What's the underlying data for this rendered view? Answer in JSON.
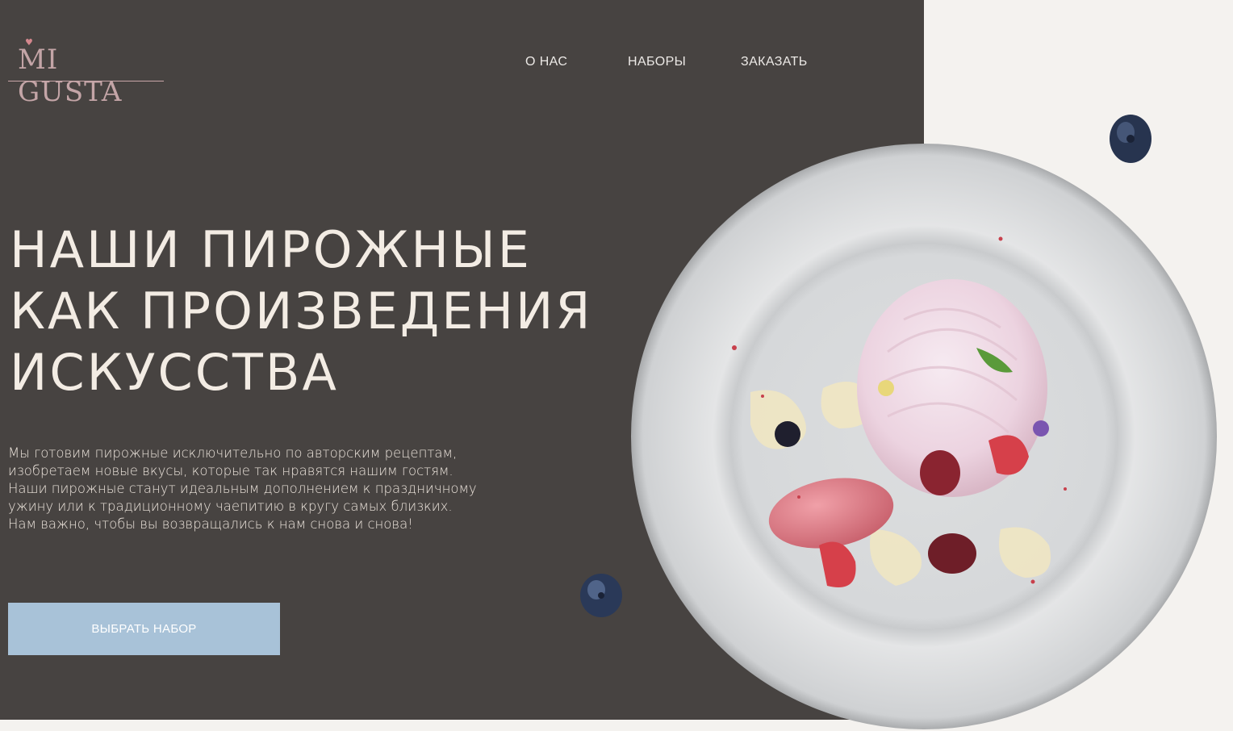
{
  "brand": {
    "logo_text": "MI GUSTA",
    "heart_glyph": "♥"
  },
  "nav": {
    "items": [
      "О НАС",
      "НАБОРЫ",
      "ЗАКАЗАТЬ"
    ]
  },
  "hero": {
    "title_lines": [
      "НАШИ ПИРОЖНЫЕ",
      "КАК ПРОИЗВЕДЕНИЯ",
      "ИСКУССТВА"
    ],
    "description_lines": [
      "Мы готовим пирожные исключительно по авторским рецептам,",
      "изобретаем новые вкусы, которые так нравятся нашим гостям.",
      "Наши пирожные станут идеальным дополнением к праздничному",
      "ужину или к традиционному чаепитию в кругу самых близких.",
      "Нам важно, чтобы вы возвращались к нам снова и снова!"
    ],
    "cta_label": "ВЫБРАТЬ НАБОР"
  },
  "colors": {
    "panel": "#474341",
    "page": "#f4f2ef",
    "accent_button": "#a8c2d8",
    "logo": "#c4a5a7",
    "title": "#f3ece4"
  },
  "icons": [
    "heart-icon",
    "blueberry-icon",
    "dessert-plate-image"
  ]
}
